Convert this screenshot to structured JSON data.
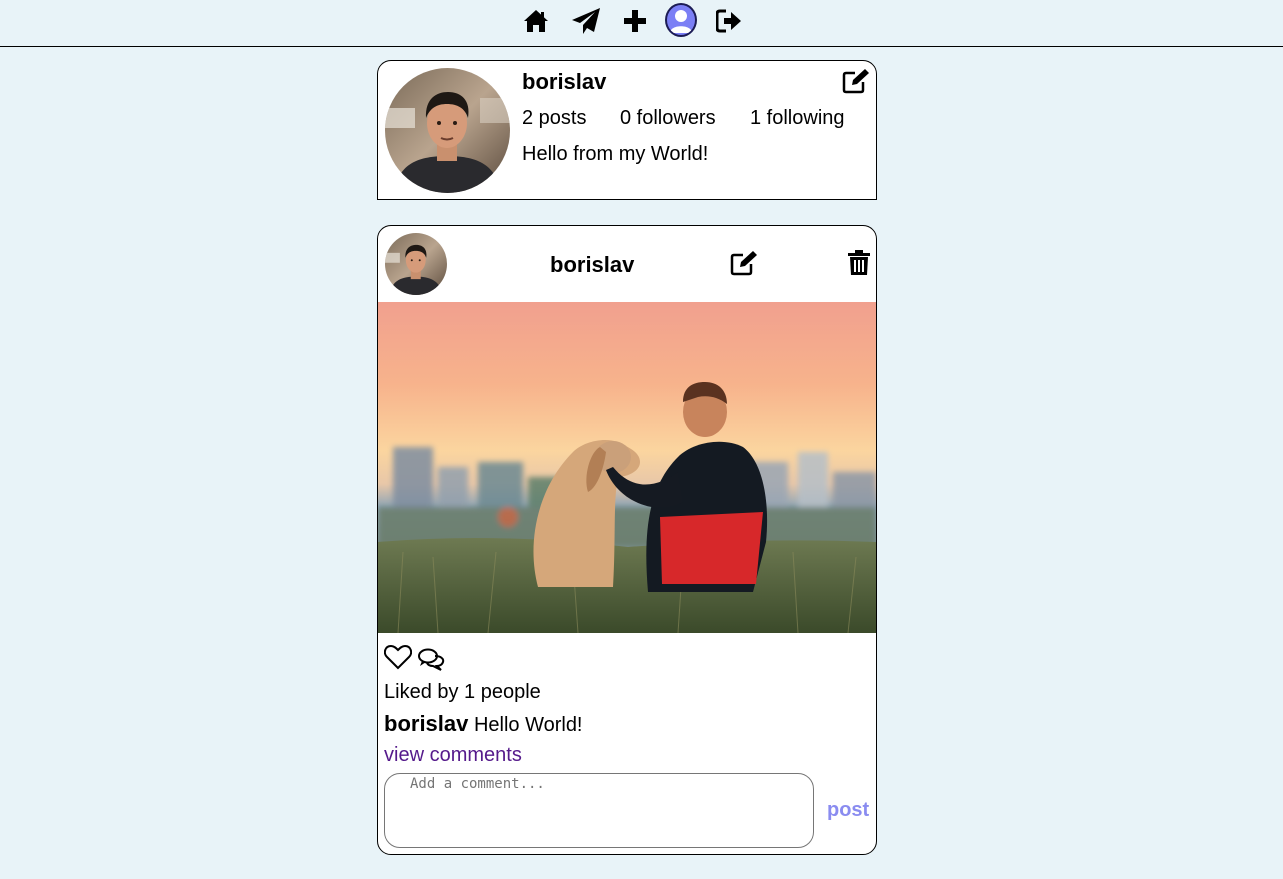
{
  "nav": {
    "icons": [
      "home-icon",
      "paper-plane-icon",
      "plus-icon",
      "user-icon",
      "sign-out-icon"
    ],
    "active_color": "#7b7ff5"
  },
  "profile": {
    "username": "borislav",
    "posts": "2 posts",
    "followers": "0 followers",
    "following": "1 following",
    "bio": "Hello from my World!"
  },
  "post": {
    "username": "borislav",
    "liked_by": "Liked by 1 people",
    "caption_user": "borislav",
    "caption_text": "Hello World!",
    "view_comments": "view comments",
    "comment_placeholder": "Add a comment...",
    "post_button": "post"
  },
  "colors": {
    "background": "#e8f3f8",
    "link": "#551a8b",
    "post_button": "#8a8cf0"
  }
}
